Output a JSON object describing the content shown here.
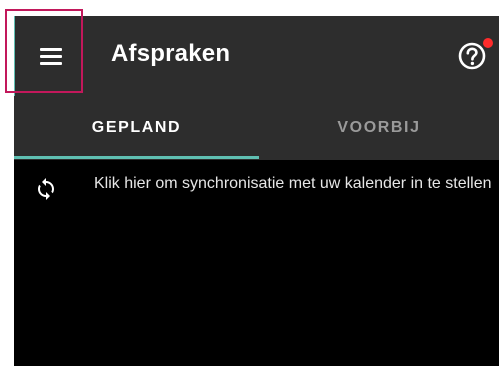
{
  "header": {
    "title": "Afspraken",
    "menu_icon": "hamburger-menu-icon",
    "help_icon": "help-circle-icon",
    "notification_dot_color": "#ff2b2b"
  },
  "tabs": [
    {
      "label": "GEPLAND",
      "selected": true
    },
    {
      "label": "VOORBIJ",
      "selected": false
    }
  ],
  "sync": {
    "icon": "sync-icon",
    "text": "Klik hier om synchronisatie met uw kalender in te stellen"
  },
  "colors": {
    "toolbar_bg": "#2d2d2d",
    "content_bg": "#000000",
    "accent": "#5fbfb2",
    "highlight_box": "#c2185b",
    "inactive_tab_text": "#9a9a9a"
  }
}
